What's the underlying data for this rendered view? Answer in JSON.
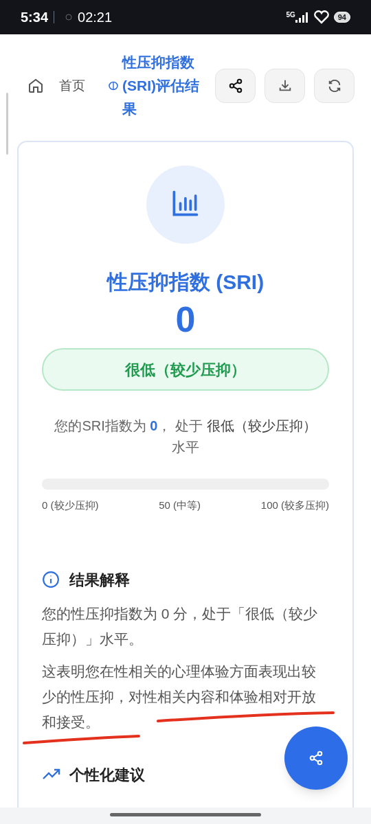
{
  "status_bar": {
    "time": "5:34",
    "clock": "02:21",
    "network": "5G",
    "battery": "94"
  },
  "header": {
    "home": "首页",
    "title": "性压抑指数(SRI)评估结果"
  },
  "result": {
    "title": "性压抑指数 (SRI)",
    "score": "0",
    "badge": "很低（较少压抑）",
    "summary": [
      {
        "text": "您的SRI指数为 ",
        "kind": "plain"
      },
      {
        "text": "0",
        "kind": "value"
      },
      {
        "text": "， 处于 ",
        "kind": "plain"
      },
      {
        "text": "很低（较少压抑）",
        "kind": "level"
      },
      {
        "text": " 水平",
        "kind": "plain"
      }
    ],
    "level": 0,
    "scale": [
      "0 (较少压抑)",
      "50 (中等)",
      "100 (较多压抑)"
    ]
  },
  "interpretation": {
    "title": "结果解释",
    "paragraphs": [
      "您的性压抑指数为 0 分，处于「很低（较少压抑）」水平。",
      "这表明您在性相关的心理体验方面表现出较少的性压抑，对性相关内容和体验相对开放和接受。"
    ],
    "annotation": {
      "kind": "underline",
      "color": "#e3311d"
    }
  },
  "suggestions": {
    "title": "个性化建议"
  }
}
